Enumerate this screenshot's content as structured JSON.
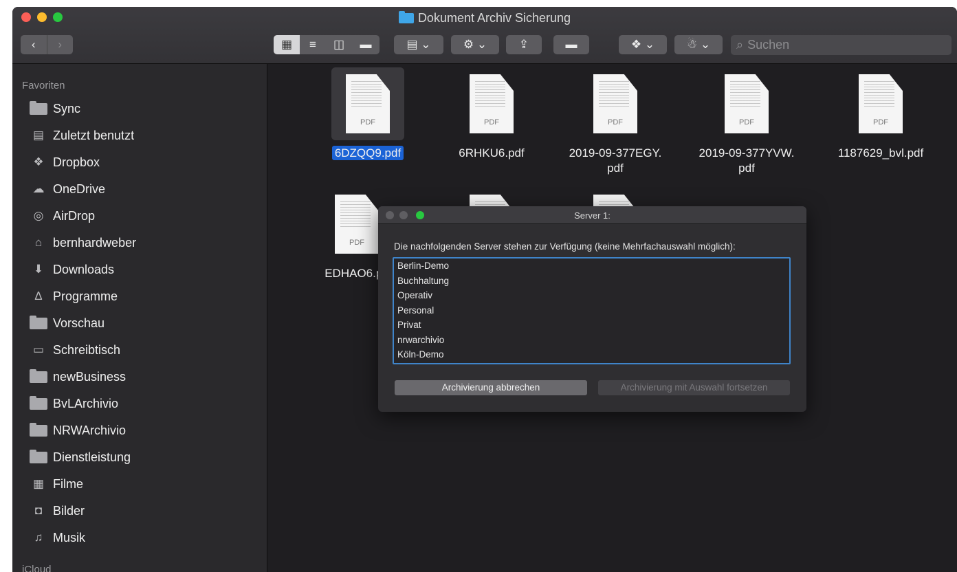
{
  "window": {
    "title": "Dokument Archiv Sicherung"
  },
  "toolbar": {
    "back_icon": "chevron-left-icon",
    "forward_icon": "chevron-right-icon",
    "search_placeholder": "Suchen"
  },
  "sidebar": {
    "favorites_header": "Favoriten",
    "icloud_header": "iCloud",
    "items": [
      {
        "label": "Sync",
        "icon": "folder-icon"
      },
      {
        "label": "Zuletzt benutzt",
        "icon": "recents-icon"
      },
      {
        "label": "Dropbox",
        "icon": "dropbox-icon"
      },
      {
        "label": "OneDrive",
        "icon": "cloud-icon"
      },
      {
        "label": "AirDrop",
        "icon": "airdrop-icon"
      },
      {
        "label": "bernhardweber",
        "icon": "home-icon"
      },
      {
        "label": "Downloads",
        "icon": "download-icon"
      },
      {
        "label": "Programme",
        "icon": "applications-icon"
      },
      {
        "label": "Vorschau",
        "icon": "folder-icon"
      },
      {
        "label": "Schreibtisch",
        "icon": "desktop-icon"
      },
      {
        "label": "newBusiness",
        "icon": "folder-icon"
      },
      {
        "label": "BvLArchivio",
        "icon": "folder-icon"
      },
      {
        "label": "NRWArchivio",
        "icon": "folder-icon"
      },
      {
        "label": "Dienstleistung",
        "icon": "folder-icon"
      },
      {
        "label": "Filme",
        "icon": "film-icon"
      },
      {
        "label": "Bilder",
        "icon": "camera-icon"
      },
      {
        "label": "Musik",
        "icon": "music-icon"
      }
    ]
  },
  "files": [
    {
      "name": "6DZQQ9.pdf",
      "badge": "PDF",
      "selected": true
    },
    {
      "name": "6RHKU6.pdf",
      "badge": "PDF"
    },
    {
      "name_line1": "2019-09-377EGY.",
      "name_line2": "pdf",
      "badge": "PDF"
    },
    {
      "name_line1": "2019-09-377YVW.",
      "name_line2": "pdf",
      "badge": "PDF"
    },
    {
      "name": "1187629_bvl.pdf",
      "badge": "PDF"
    },
    {
      "name": "EDHAO6.pd",
      "badge": "PDF"
    }
  ],
  "dialog": {
    "title": "Server 1:",
    "prompt": "Die nachfolgenden Server stehen zur Verfügung (keine Mehrfachauswahl möglich):",
    "servers": [
      "Berlin-Demo",
      "Buchhaltung",
      "Operativ",
      "Personal",
      "Privat",
      "nrwarchivio",
      "Köln-Demo"
    ],
    "cancel_label": "Archivierung abbrechen",
    "continue_label": "Archivierung mit Auswahl fortsetzen"
  }
}
